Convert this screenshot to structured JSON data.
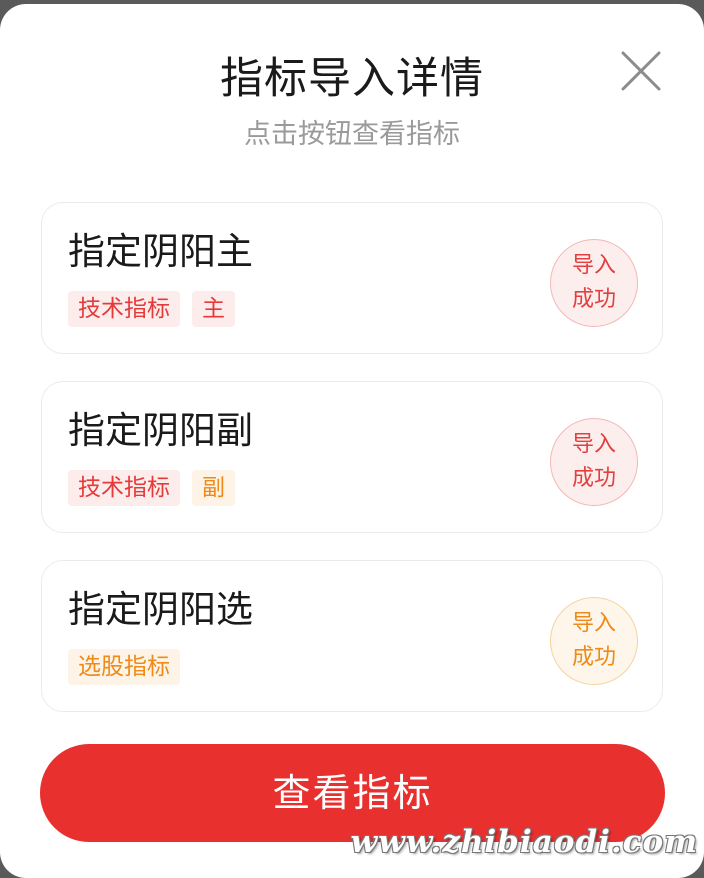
{
  "dialog": {
    "title": "指标导入详情",
    "subtitle": "点击按钮查看指标",
    "close_icon": "close-icon"
  },
  "indicators": [
    {
      "name": "指定阴阳主",
      "tags": [
        {
          "label": "技术指标",
          "color": "#e53a3a"
        },
        {
          "label": "主",
          "color": "#e53a3a"
        }
      ],
      "status": [
        "导入",
        "成功"
      ],
      "status_color": "#e24040"
    },
    {
      "name": "指定阴阳副",
      "tags": [
        {
          "label": "技术指标",
          "color": "#e53a3a"
        },
        {
          "label": "副",
          "color": "#ef8a18"
        }
      ],
      "status": [
        "导入",
        "成功"
      ],
      "status_color": "#e24040"
    },
    {
      "name": "指定阴阳选",
      "tags": [
        {
          "label": "选股指标",
          "color": "#ef8a18"
        }
      ],
      "status": [
        "导入",
        "成功"
      ],
      "status_color": "#ef8a18"
    }
  ],
  "action": {
    "view_label": "查看指标",
    "color": "#e8302f"
  },
  "watermark": "www.zhibiaodi.com"
}
